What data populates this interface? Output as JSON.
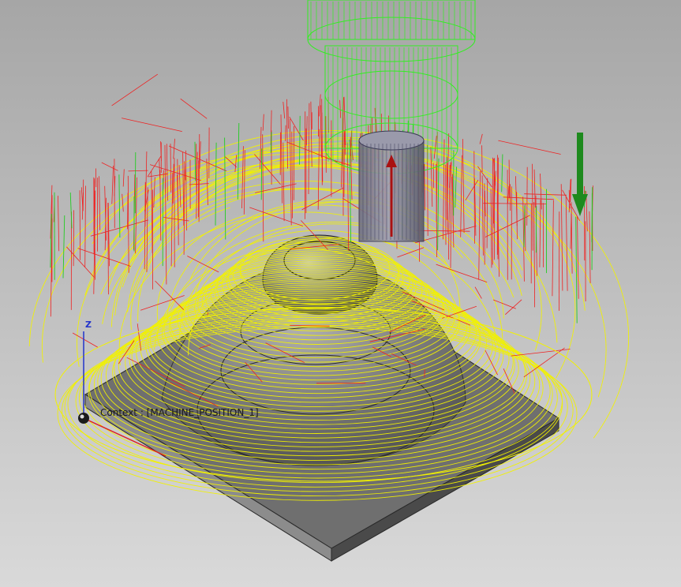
{
  "viewport": {
    "context_text": "Context : [MACHINE_POSITION_1]",
    "axis_label": "Z"
  },
  "icons": [
    "tool-holder-icon",
    "cutting-tool-icon",
    "feed-direction-arrow-icon",
    "coordinate-triad-icon"
  ],
  "colors": {
    "background_top": "#a6a6a6",
    "background_bottom": "#d9d9d9",
    "holder": "#33ee22",
    "cutting_moves": "#f2f200",
    "rapid_moves": "#ee2222",
    "stock": "#6f6f6f",
    "arrow": "#1e8a1e",
    "axis_z": "#2233cc",
    "axis_x": "#dd2222"
  }
}
